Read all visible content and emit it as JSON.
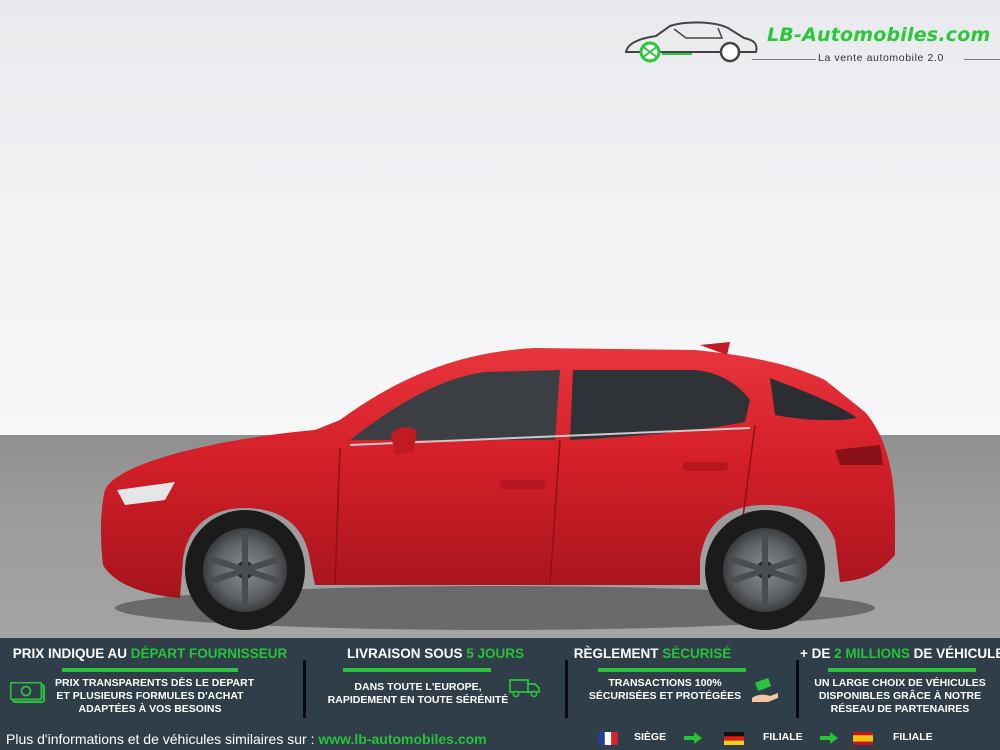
{
  "logo": {
    "brand": "LB-Automobiles.com",
    "tagline": "La vente automobile 2.0",
    "brand_color": "#2bc83a"
  },
  "car": {
    "color": "#d8202a",
    "icon": "hatchback-car"
  },
  "banner": {
    "background": "#2f3e48",
    "accent": "#29c23a",
    "features": [
      {
        "title_main": "PRIX INDIQUE AU ",
        "title_accent": "DÉPART FOURNISSEUR",
        "desc_lines": [
          "PRIX TRANSPARENTS DÈS LE DEPART",
          "ET PLUSIEURS FORMULES D'ACHAT",
          "ADAPTÉES À VOS BESOINS"
        ],
        "icon": "money-icon"
      },
      {
        "title_main": "LIVRAISON SOUS ",
        "title_accent": "5 JOURS",
        "desc_lines": [
          "DANS TOUTE L'EUROPE,",
          "RAPIDEMENT EN TOUTE SÉRÉNITÉ"
        ],
        "icon": "delivery-truck-icon"
      },
      {
        "title_main": "RÈGLEMENT ",
        "title_accent": "SÉCURISÉ",
        "desc_lines": [
          "TRANSACTIONS 100%",
          "SÉCURISÉES ET PROTÉGÉES"
        ],
        "icon": "payment-hand-icon"
      },
      {
        "title_main": "+ DE ",
        "title_accent": "2 MILLIONS",
        "title_end": " DE VÉHICULES",
        "desc_lines": [
          "UN LARGE CHOIX DE VÉHICULES",
          "DISPONIBLES GRÂCE À NOTRE",
          "RÉSEAU DE PARTENAIRES"
        ]
      }
    ],
    "footer_text": "Plus d'informations et de véhicules similaires sur : ",
    "footer_link": "www.lb-automobiles.com",
    "locations": [
      {
        "flag": "france-flag",
        "label": "SIÈGE"
      },
      {
        "flag": "germany-flag",
        "label": "FILIALE"
      },
      {
        "flag": "spain-flag",
        "label": "FILIALE"
      }
    ]
  }
}
